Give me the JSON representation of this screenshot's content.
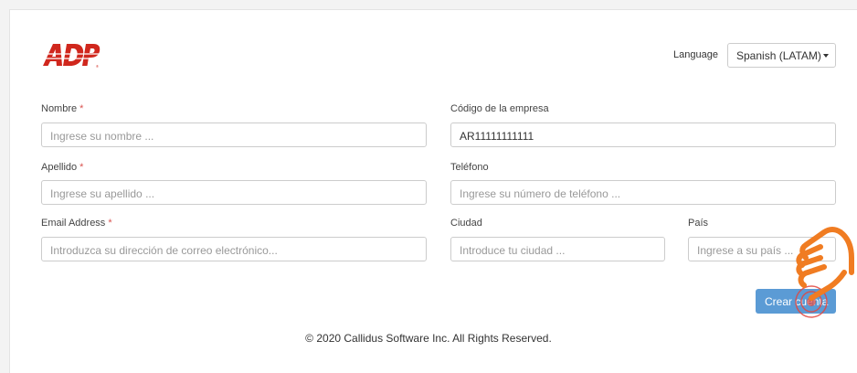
{
  "brand": {
    "logo_text": "ADP",
    "logo_color": "#d0271d"
  },
  "language": {
    "label": "Language",
    "selected": "Spanish (LATAM)"
  },
  "form": {
    "nombre": {
      "label": "Nombre",
      "required": "*",
      "placeholder": "Ingrese su nombre ..."
    },
    "codigo": {
      "label": "Código de la empresa",
      "value": "AR11111111111"
    },
    "apellido": {
      "label": "Apellido",
      "required": "*",
      "placeholder": "Ingrese su apellido ..."
    },
    "telefono": {
      "label": "Teléfono",
      "placeholder": "Ingrese su número de teléfono ..."
    },
    "email": {
      "label": "Email Address",
      "required": "*",
      "placeholder": "Introduzca su dirección de correo electrónico..."
    },
    "ciudad": {
      "label": "Ciudad",
      "placeholder": "Introduce tu ciudad ..."
    },
    "pais": {
      "label": "País",
      "placeholder": "Ingrese a su país ..."
    },
    "submit_label": "Crear cuenta"
  },
  "footer": {
    "text": "© 2020 Callidus Software Inc. All Rights Reserved."
  },
  "colors": {
    "accent": "#5b9bd5",
    "required": "#d9534f",
    "cursor": "#f07c22"
  },
  "cursor": {
    "icon": "hand-pointer-icon"
  }
}
